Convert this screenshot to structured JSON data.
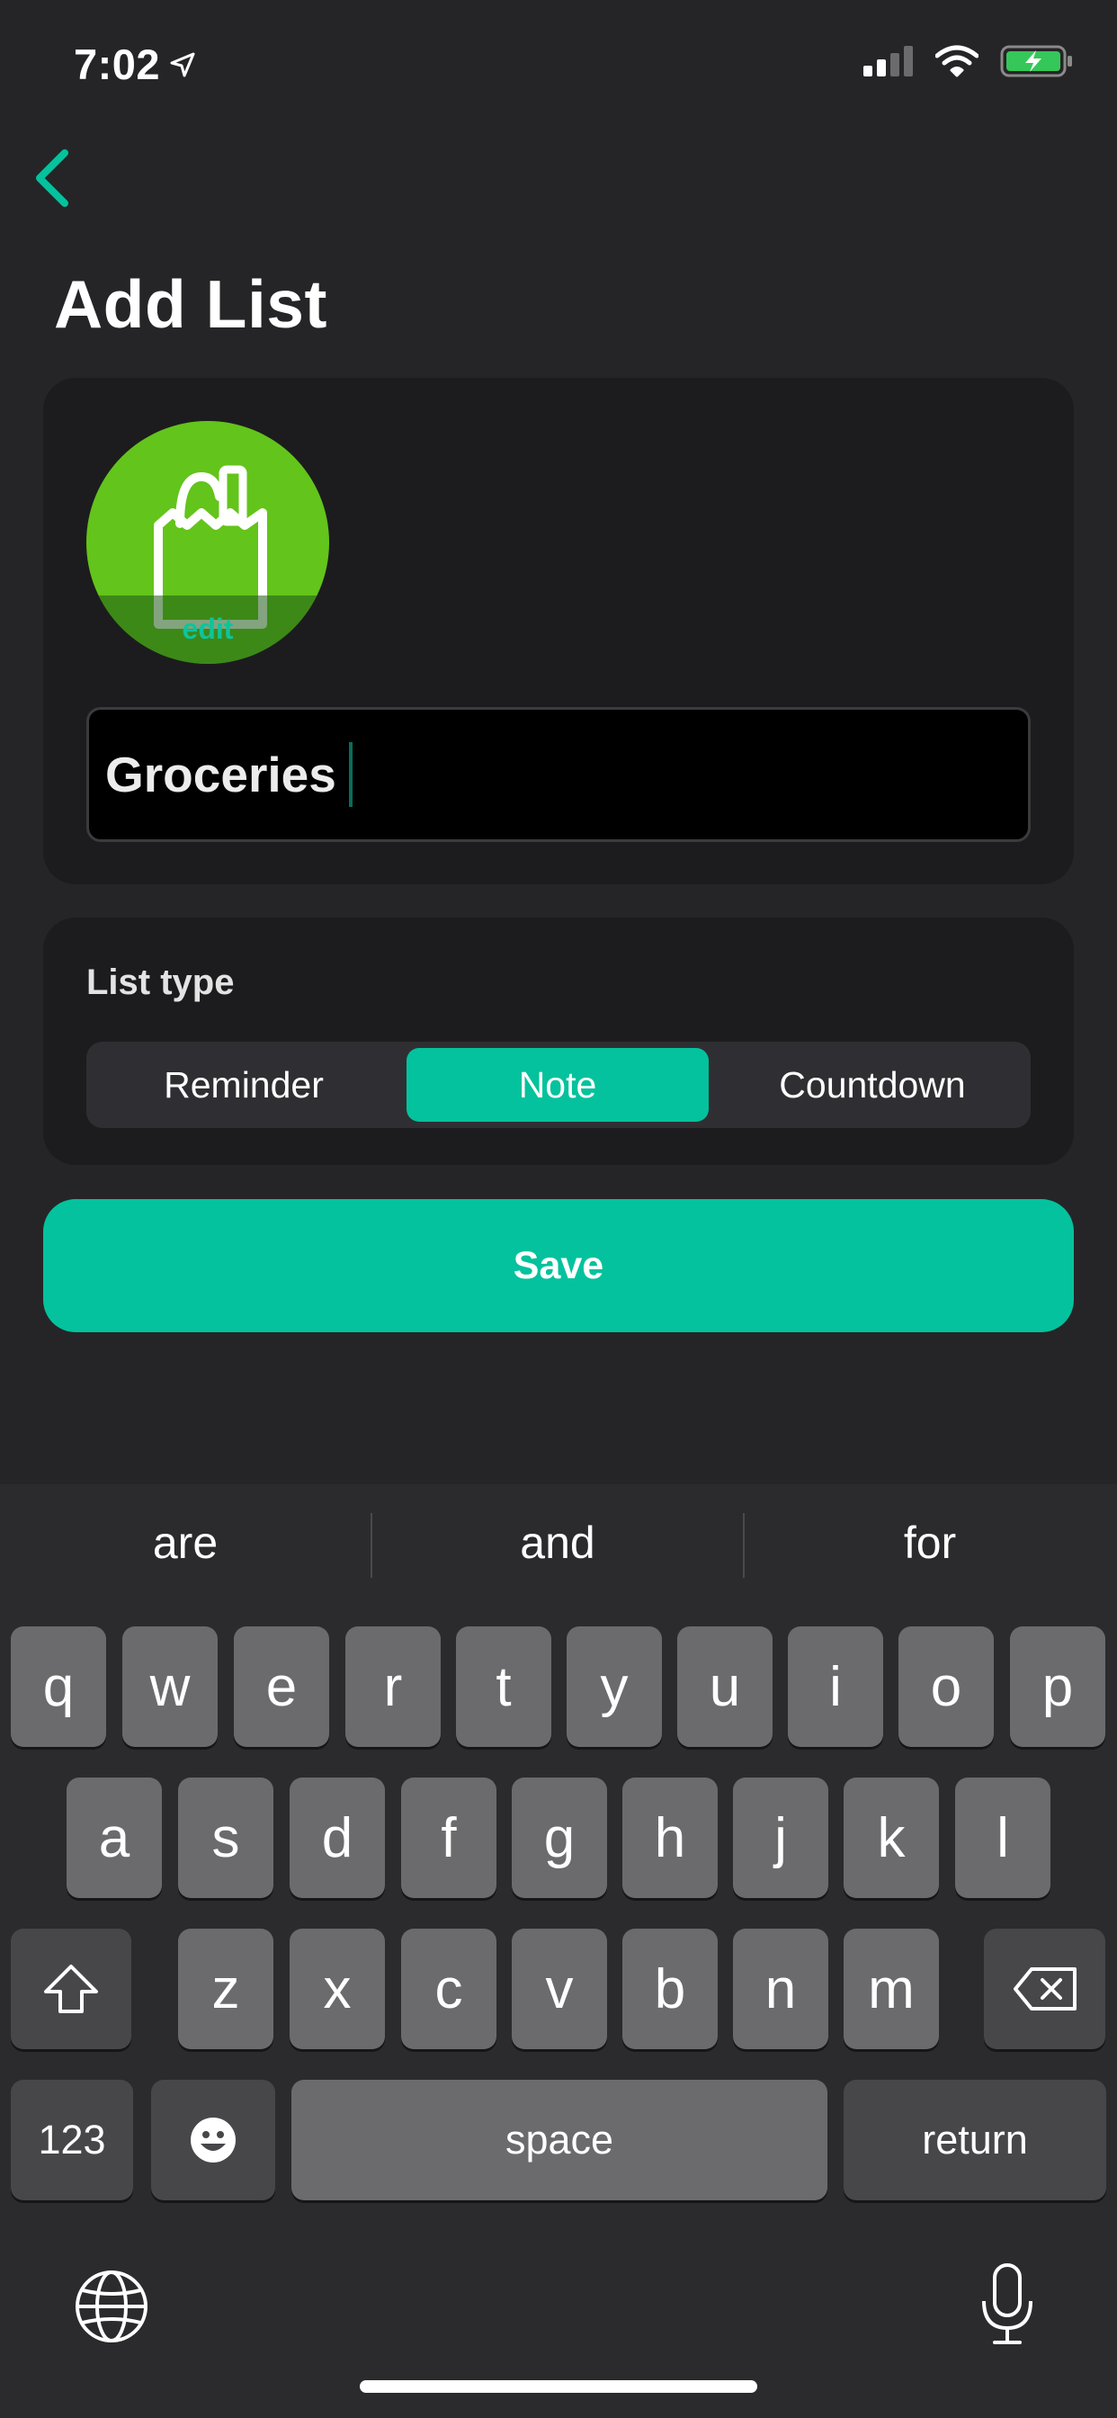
{
  "status_bar": {
    "time": "7:02",
    "icons": [
      "location-arrow-icon",
      "cellular-signal-icon",
      "wifi-icon",
      "battery-charging-icon"
    ]
  },
  "nav": {
    "back_icon": "chevron-left-icon"
  },
  "page": {
    "title": "Add List"
  },
  "list_icon": {
    "icon": "grocery-bag-icon",
    "edit_label": "edit",
    "color": "#63c41b"
  },
  "name_input": {
    "value": "Groceries"
  },
  "list_type": {
    "label": "List type",
    "options": [
      "Reminder",
      "Note",
      "Countdown"
    ],
    "selected": "Note"
  },
  "save_button": {
    "label": "Save"
  },
  "colors": {
    "accent": "#04c29d",
    "background": "#252527",
    "card": "#1c1c1e"
  },
  "keyboard": {
    "suggestions": [
      "are",
      "and",
      "for"
    ],
    "row1": [
      "q",
      "w",
      "e",
      "r",
      "t",
      "y",
      "u",
      "i",
      "o",
      "p"
    ],
    "row2": [
      "a",
      "s",
      "d",
      "f",
      "g",
      "h",
      "j",
      "k",
      "l"
    ],
    "row3": [
      "z",
      "x",
      "c",
      "v",
      "b",
      "n",
      "m"
    ],
    "numbers_key": "123",
    "space_key": "space",
    "return_key": "return"
  }
}
